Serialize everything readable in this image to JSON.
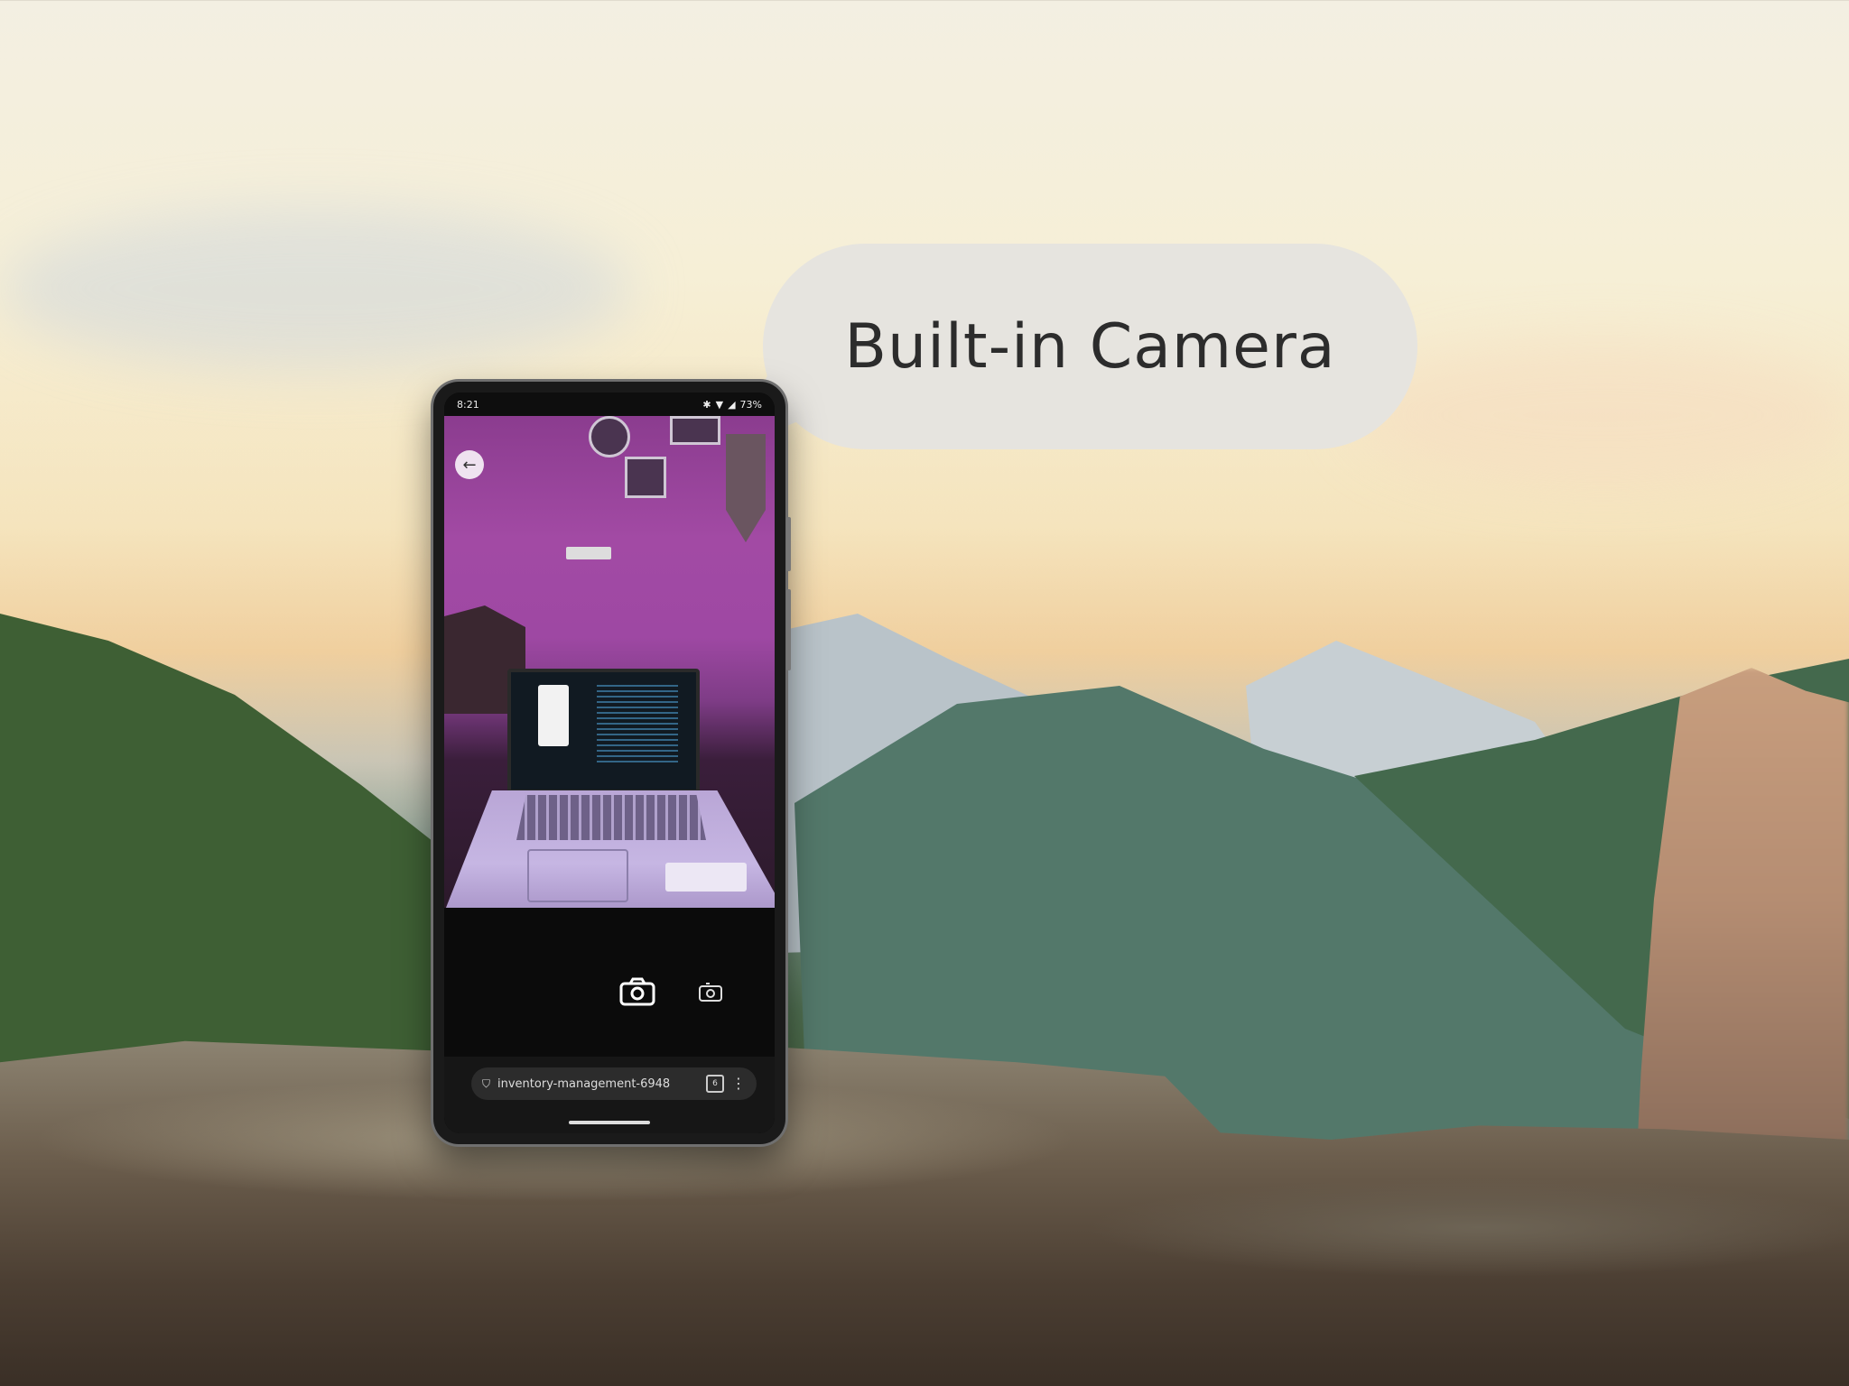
{
  "callout": {
    "label": "Built-in Camera"
  },
  "phone": {
    "status": {
      "time": "8:21",
      "battery": "73%",
      "icons": [
        "bluetooth-icon",
        "wifi-icon",
        "signal-icon",
        "battery-icon"
      ]
    },
    "camera": {
      "back_icon": "arrow-left-icon",
      "shutter_icon": "camera-icon",
      "switch_icon": "camera-switch-icon"
    },
    "browser": {
      "url": "inventory-management-6948",
      "tab_count": "6",
      "menu_icon": "more-vert-icon",
      "security_icon": "shield-icon"
    }
  },
  "colors": {
    "bubble": "#e6e4df",
    "bubble_text": "#2c2c2c",
    "viewfinder_wall": "#9e48a3"
  }
}
